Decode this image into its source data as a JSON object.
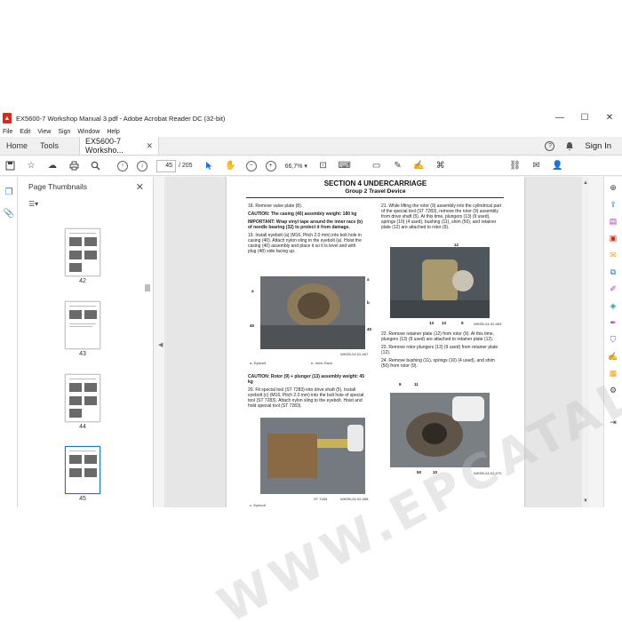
{
  "window": {
    "title": "EX5600-7 Workshop Manual  3.pdf - Adobe Acrobat Reader DC (32-bit)",
    "controls": [
      "—",
      "☐",
      "✕"
    ]
  },
  "menu": [
    "File",
    "Edit",
    "View",
    "Sign",
    "Window",
    "Help"
  ],
  "tabs": {
    "home": "Home",
    "tools": "Tools",
    "document": "EX5600-7 Worksho...",
    "sign_in": "Sign In"
  },
  "toolbar": {
    "page_current": "45",
    "page_total": "/ 205",
    "zoom": "66,7%"
  },
  "thumbnails": {
    "title": "Page Thumbnails",
    "pages": [
      "42",
      "43",
      "44",
      "45"
    ]
  },
  "document": {
    "section": "SECTION 4 UNDERCARRIAGE",
    "group": "Group 2 Travel Device",
    "left_column": {
      "step18": "18.  Remove valve plate (8).",
      "caution1": "CAUTION:  The casing (40) assembly weight: 180 kg",
      "important": "IMPORTANT:  Wrap vinyl tape around the inner race (b) of needle bearing (32) to protect it from damage.",
      "step19": "19.  Install eyebolt (a) (M16, Pitch 2.0 mm) into bolt hole in casing (40). Attach nylon sling to the eyebolt (a). Hoist the casing (40) assembly and place it so it is level and with plug (48) side facing up.",
      "fig1_callouts": [
        "a",
        "b",
        "40",
        "40",
        "a"
      ],
      "fig1_code": "WKEB-04-02-067",
      "legend1_a": "a-      Eyebolt",
      "legend1_b": "b-      Inner Race",
      "caution2": "CAUTION:  Rotor (9) + plunger (13) assembly weight: 45 kg",
      "step20": "20.  Fit special tool (ST 7283) into drive shaft (5). Install eyebolt (c) (M16, Pitch 2.0 mm) into the bolt hole of special tool (ST 7283). Attach nylon sling to the eyebolt. Hoist and hold special tool (ST 7283).",
      "fig2_tool": "ST 7283",
      "fig2_code": "WKEB-04-02-068",
      "legend2": "c-      Eyebolt"
    },
    "right_column": {
      "step21": "21.  While lifting the rotor (9) assembly into the cylindrical part of the special tool (ST 7283), remove the rotor (9) assembly from drive shaft (5). At this time, plungers (13) (9 used), springs (10) (4 used), bushing (11), shim (50), and retainer plate (12) are attached to rotor (9).",
      "fig3_callouts": [
        "12",
        "13",
        "13",
        "9"
      ],
      "fig3_code": "WKEB-04-02-069",
      "step22": "22.  Remove retainer plate (12) from rotor (9). At this time, plungers (13) (9 used) are attached to retainer plate (12).",
      "step23": "23.  Remove rotor plungers (13) (9 used) from retainer plate (12).",
      "step24": "24.  Remove bushing (11), springs (10) (4 used), and shim (50) from rotor (9).",
      "fig4_callouts": [
        "9",
        "11",
        "50",
        "10"
      ],
      "fig4_code": "WKEB-04-02-070"
    }
  },
  "watermark": "WWW.EPCATALOGS.COM",
  "colors": {
    "accent": "#1473e6",
    "pdf_red": "#d9291c",
    "doc_background": "#e6e6e6"
  }
}
